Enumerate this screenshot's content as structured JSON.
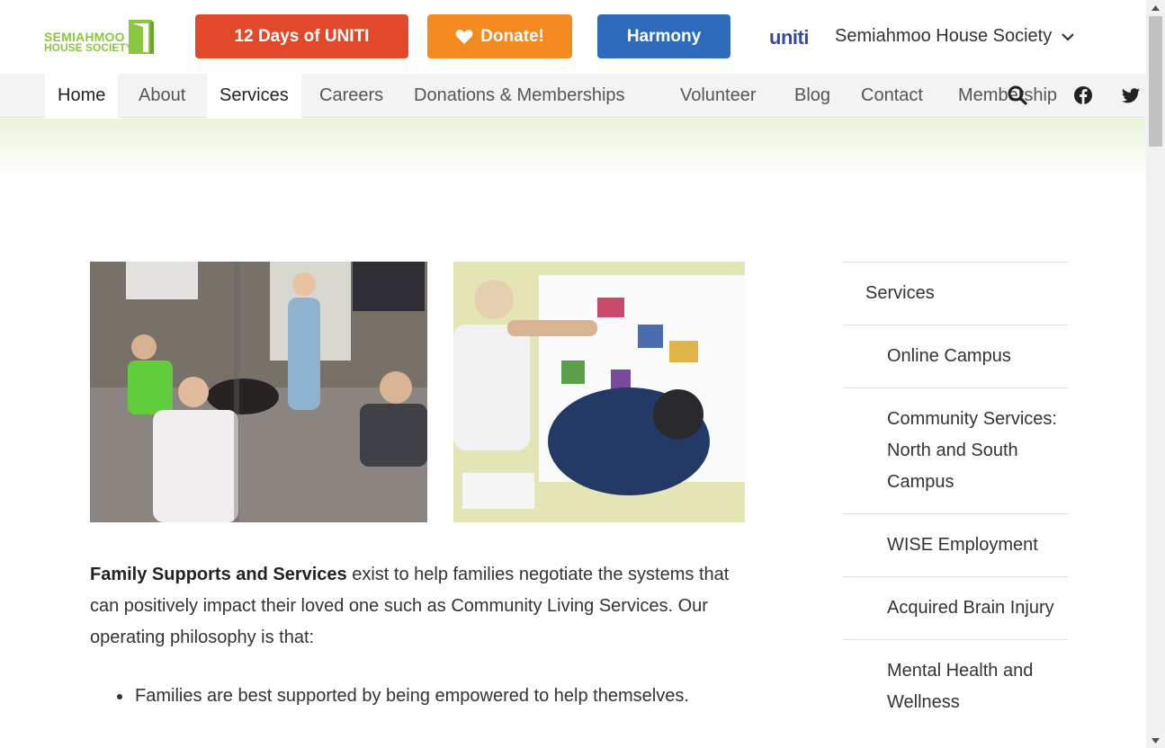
{
  "header": {
    "logo_line1": "SEMIAHMOO",
    "logo_line2": "HOUSE SOCIETY",
    "btn_12days": "12 Days of UNITI",
    "btn_donate": "Donate!",
    "btn_harmony": "Harmony",
    "uniti_logo": "uniti",
    "org_select": "Semiahmoo House Society"
  },
  "nav": {
    "items": [
      {
        "label": "Home"
      },
      {
        "label": "About"
      },
      {
        "label": "Services"
      },
      {
        "label": "Careers"
      },
      {
        "label": "Donations & Memberships"
      },
      {
        "label": "Volunteer"
      },
      {
        "label": "Blog"
      },
      {
        "label": "Contact"
      },
      {
        "label": "Membership"
      }
    ]
  },
  "content": {
    "intro_bold": "Family Supports and Services",
    "intro_rest": " exist to help families negotiate the systems that can positively impact their loved one such as Community Living Services. Our operating philosophy is that:",
    "bullets": [
      "Families are best supported by being empowered to help themselves."
    ]
  },
  "sidebar": {
    "items": [
      {
        "label": "Services"
      },
      {
        "label": "Online Campus"
      },
      {
        "label": "Community Services: North and South Campus"
      },
      {
        "label": "WISE Employment"
      },
      {
        "label": "Acquired Brain Injury"
      },
      {
        "label": "Mental Health and Wellness"
      }
    ]
  },
  "colors": {
    "btn_12days": "#e04a2a",
    "btn_donate": "#f28a1e",
    "btn_harmony": "#2f6bbd",
    "brand_green": "#8cc63f"
  },
  "icons": {
    "search": "search-icon",
    "facebook": "facebook-icon",
    "twitter": "twitter-icon",
    "heart": "heart-icon",
    "chevron": "chevron-down-icon"
  }
}
